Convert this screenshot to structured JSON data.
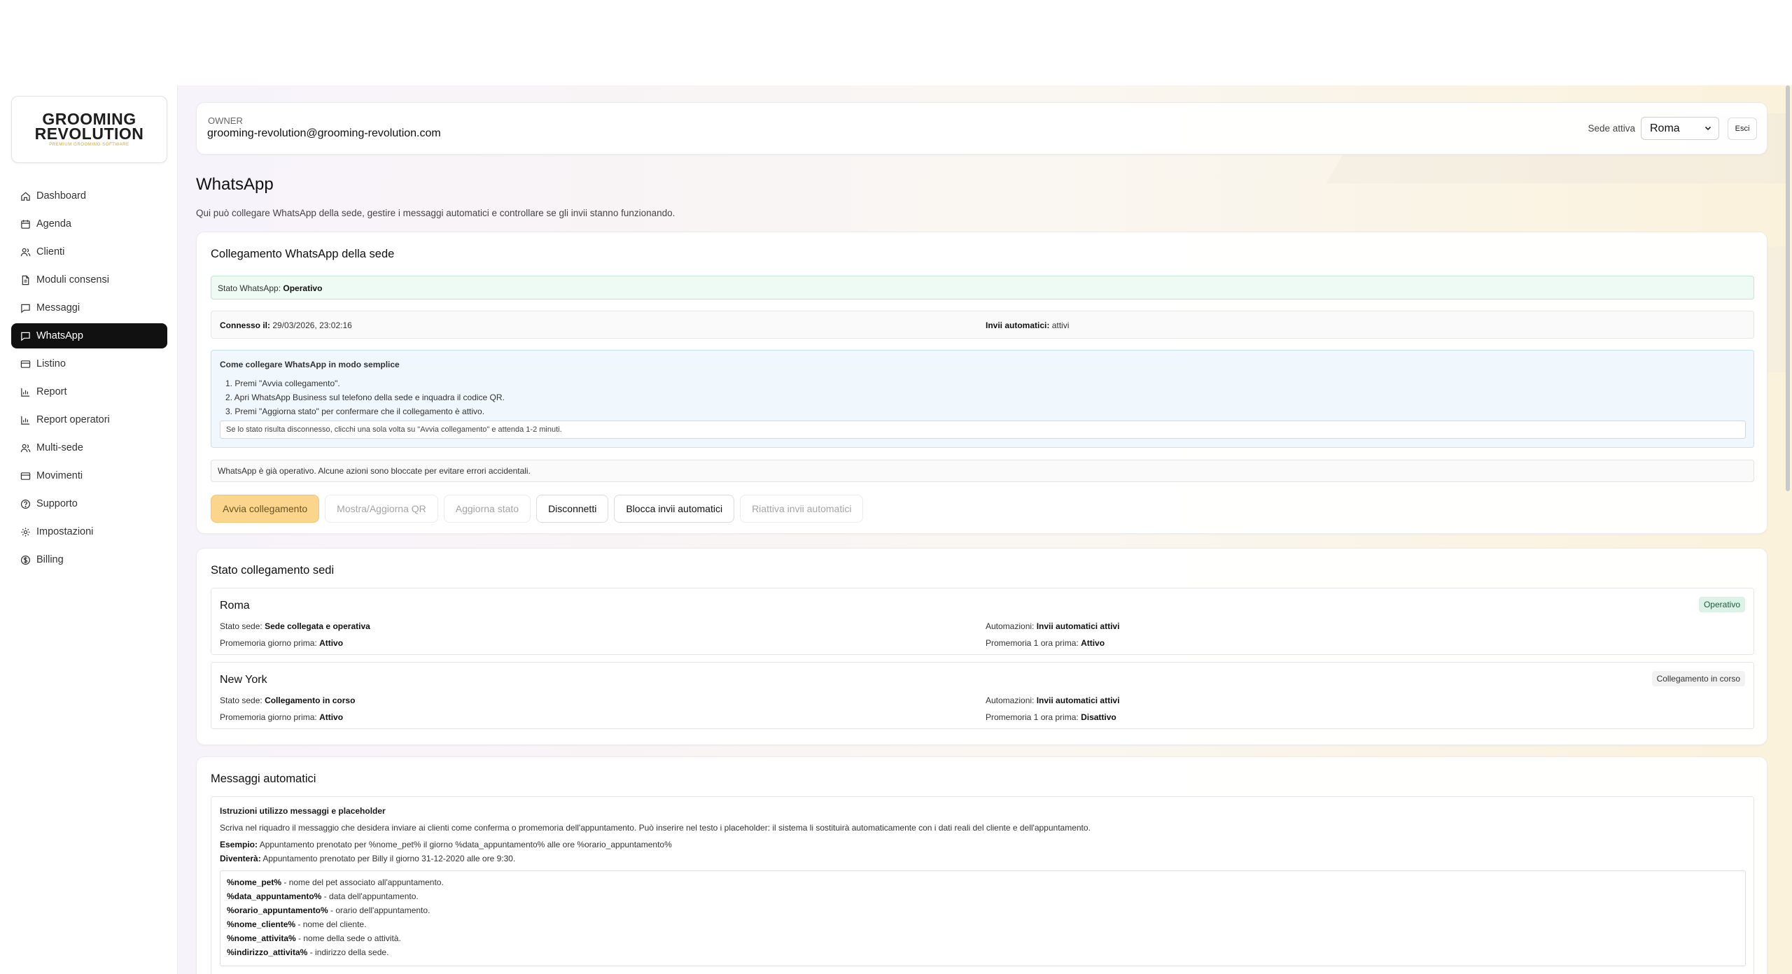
{
  "brand": {
    "line1": "GROOMING",
    "line2": "REVOLUTION",
    "tagline": "PREMIUM GROOMING SOFTWARE"
  },
  "sidebar": {
    "items": [
      {
        "label": "Dashboard",
        "icon": "home-icon"
      },
      {
        "label": "Agenda",
        "icon": "calendar-icon"
      },
      {
        "label": "Clienti",
        "icon": "users-icon"
      },
      {
        "label": "Moduli consensi",
        "icon": "document-icon"
      },
      {
        "label": "Messaggi",
        "icon": "message-icon"
      },
      {
        "label": "WhatsApp",
        "icon": "message-icon",
        "active": true
      },
      {
        "label": "Listino",
        "icon": "card-icon"
      },
      {
        "label": "Report",
        "icon": "bar-chart-icon"
      },
      {
        "label": "Report operatori",
        "icon": "bar-chart-icon"
      },
      {
        "label": "Multi-sede",
        "icon": "users-icon"
      },
      {
        "label": "Movimenti",
        "icon": "card-icon"
      },
      {
        "label": "Supporto",
        "icon": "help-icon"
      },
      {
        "label": "Impostazioni",
        "icon": "gear-icon"
      },
      {
        "label": "Billing",
        "icon": "billing-icon"
      }
    ]
  },
  "header": {
    "role": "OWNER",
    "email": "grooming-revolution@grooming-revolution.com",
    "sede_label": "Sede attiva",
    "sede_value": "Roma",
    "logout_label": "Esci"
  },
  "page": {
    "title": "WhatsApp",
    "subtitle": "Qui può collegare WhatsApp della sede, gestire i messaggi automatici e controllare se gli invii stanno funzionando."
  },
  "connection": {
    "title": "Collegamento WhatsApp della sede",
    "status_label": "Stato WhatsApp:",
    "status_value": "Operativo",
    "connected_label": "Connesso il:",
    "connected_value": "29/03/2026, 23:02:16",
    "auto_label": "Invii automatici:",
    "auto_value": "attivi",
    "howto_title": "Come collegare WhatsApp in modo semplice",
    "steps": [
      "1. Premi \"Avvia collegamento\".",
      "2. Apri WhatsApp Business sul telefono della sede e inquadra il codice QR.",
      "3. Premi \"Aggiorna stato\" per confermare che il collegamento è attivo."
    ],
    "note": "Se lo stato risulta disconnesso, clicchi una sola volta su \"Avvia collegamento\" e attenda 1-2 minuti.",
    "warning": "WhatsApp è già operativo. Alcune azioni sono bloccate per evitare errori accidentali.",
    "buttons": {
      "start": "Avvia collegamento",
      "qr": "Mostra/Aggiorna QR",
      "refresh": "Aggiorna stato",
      "disconnect": "Disconnetti",
      "block": "Blocca invii automatici",
      "reactivate": "Riattiva invii automatici"
    }
  },
  "sedi": {
    "title": "Stato collegamento sedi",
    "stato_label": "Stato sede:",
    "auto_label": "Automazioni:",
    "reminder_day_label": "Promemoria giorno prima:",
    "reminder_hour_label": "Promemoria 1 ora prima:",
    "list": [
      {
        "name": "Roma",
        "badge": "Operativo",
        "stato": "Sede collegata e operativa",
        "auto": "Invii automatici attivi",
        "reminder_day": "Attivo",
        "reminder_hour": "Attivo"
      },
      {
        "name": "New York",
        "badge": "Collegamento in corso",
        "stato": "Collegamento in corso",
        "auto": "Invii automatici attivi",
        "reminder_day": "Attivo",
        "reminder_hour": "Disattivo"
      }
    ]
  },
  "messages": {
    "title": "Messaggi automatici",
    "instr_title": "Istruzioni utilizzo messaggi e placeholder",
    "instr_text": "Scriva nel riquadro il messaggio che desidera inviare ai clienti come conferma o promemoria dell'appuntamento. Può inserire nel testo i placeholder: il sistema li sostituirà automaticamente con i dati reali del cliente e dell'appuntamento.",
    "example_label": "Esempio:",
    "example_text": "Appuntamento prenotato per %nome_pet% il giorno %data_appuntamento% alle ore %orario_appuntamento%",
    "result_label": "Diventerà:",
    "result_text": "Appuntamento prenotato per Billy il giorno 31-12-2020 alle ore 9:30.",
    "placeholders": [
      {
        "key": "%nome_pet%",
        "desc": " - nome del pet associato all'appuntamento."
      },
      {
        "key": "%data_appuntamento%",
        "desc": " - data dell'appuntamento."
      },
      {
        "key": "%orario_appuntamento%",
        "desc": " - orario dell'appuntamento."
      },
      {
        "key": "%nome_cliente%",
        "desc": " - nome del cliente."
      },
      {
        "key": "%nome_attivita%",
        "desc": " - nome della sede o attività."
      },
      {
        "key": "%indirizzo_attivita%",
        "desc": " - indirizzo della sede."
      }
    ]
  }
}
